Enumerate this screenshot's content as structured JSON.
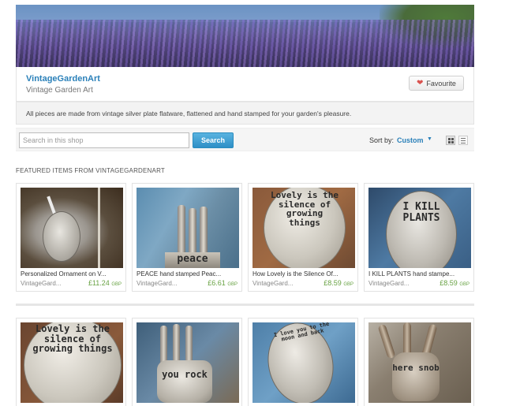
{
  "banner": {
    "alt": "lavender field"
  },
  "shop": {
    "name": "VintageGardenArt",
    "subtitle": "Vintage Garden Art",
    "favourite_label": "Favourite",
    "announcement": "All pieces are made from vintage silver plate flatware, flattened and hand stamped for your garden's pleasure."
  },
  "search": {
    "placeholder": "Search in this shop",
    "button_label": "Search",
    "sort_label": "Sort by:",
    "sort_value": "Custom"
  },
  "section": {
    "title": "FEATURED ITEMS FROM VINTAGEGARDENART"
  },
  "items": [
    {
      "title": "Personalized Ornament on V...",
      "seller": "VintageGard...",
      "price": "£11.24",
      "currency": "GBP"
    },
    {
      "title": "PEACE hand stamped Peac...",
      "seller": "VintageGard...",
      "price": "£6.61",
      "currency": "GBP",
      "engraving": "peace"
    },
    {
      "title": "How Lovely is the Silence Of...",
      "seller": "VintageGard...",
      "price": "£8.59",
      "currency": "GBP",
      "engraving": "Lovely is the silence of growing things"
    },
    {
      "title": "I KILL PLANTS hand stampe...",
      "seller": "VintageGard...",
      "price": "£8.59",
      "currency": "GBP",
      "engraving": "I KILL PLANTS"
    }
  ],
  "items_row2": [
    {
      "engraving": "Lovely is the silence of growing things"
    },
    {
      "engraving": "you rock"
    },
    {
      "engraving": "I love you to the moon and back"
    },
    {
      "engraving": "here snob"
    }
  ],
  "colors": {
    "link": "#2a80b9",
    "price": "#68a243",
    "search_button": "#2e8fc6"
  }
}
